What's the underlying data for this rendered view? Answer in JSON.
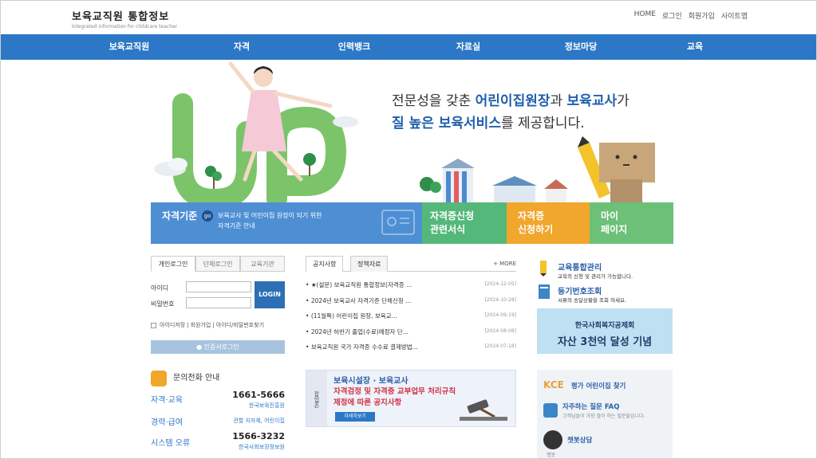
{
  "header": {
    "logo_title": "보육교직원 통합정보",
    "logo_subtitle": "Integrated information for childcare teacher",
    "util_links": [
      "HOME",
      "로그인",
      "회원가입",
      "사이트맵"
    ]
  },
  "nav": {
    "items": [
      "보육교직원",
      "자격",
      "인력뱅크",
      "자료실",
      "정보마당",
      "교육"
    ]
  },
  "hero": {
    "line1_pre": "전문성을 갖춘 ",
    "line1_hl1": "어린이집원장",
    "line1_mid": "과 ",
    "line1_hl2": "보육교사",
    "line1_post": "가",
    "line2_hl": "질 높은 보육서비스",
    "line2_post": "를 제공합니다."
  },
  "quickbar": {
    "qual_title": "자격기준",
    "go": "go",
    "qual_desc1": "보육교사 및 어린이집 원장이 되기 위한",
    "qual_desc2": "자격기준 안내",
    "apply_forms": [
      "자격증신청",
      "관련서식"
    ],
    "apply_cert": [
      "자격증",
      "신청하기"
    ],
    "mypage": [
      "마이",
      "페이지"
    ]
  },
  "login": {
    "tabs": [
      "개인로그인",
      "단체로그인",
      "교육기관"
    ],
    "id_label": "아이디",
    "pw_label": "비밀번호",
    "login_button": "LOGIN",
    "save_id": "아이디저장",
    "join": "회원가입",
    "find": "아이디/비밀번호찾기",
    "cert_login": "인증서로그인"
  },
  "inquiry": {
    "title": "문의전화 안내",
    "rows": [
      {
        "category": "자격·교육",
        "number": "1661-5666",
        "org": "한국보육진흥원"
      },
      {
        "category": "경력·급여",
        "number": "관할 지자체, 어린이집",
        "org": ""
      },
      {
        "category": "시스템 오류",
        "number": "1566-3232",
        "org": "한국사회보장정보원"
      }
    ]
  },
  "notice": {
    "tabs": [
      "공지사항",
      "정책자료"
    ],
    "more": "MORE",
    "items": [
      {
        "title": "★(설문) 보육교직원 통합정보(자격증 ...",
        "date": "[2024-12-05]"
      },
      {
        "title": "2024년 보육교사 자격기준 단체신청 ...",
        "date": "[2024-10-28]"
      },
      {
        "title": "(11월특) 어린이집 원장, 보육교...",
        "date": "[2024-09-19]"
      },
      {
        "title": "2024년 하반기 졸업(수료)예정자 단...",
        "date": "[2024-08-08]"
      },
      {
        "title": "보육교직원 국가 자격증 수수료 결제방법...",
        "date": "[2024-07-18]"
      }
    ]
  },
  "banner": {
    "side": "팝업존",
    "line1": "보육시설장 · 보육교사",
    "line2": "자격검정 및 자격증 교부업무 처리규칙",
    "line3": "제정에 따른 공지사항",
    "button": "자세히보기"
  },
  "right": {
    "edu_title": "교육통합관리",
    "edu_desc": "교육의 신청 및 관리가 가능합니다.",
    "reg_title": "등기번호조회",
    "reg_desc": "서류의 송달상황을 조회 하세요.",
    "banner_line1": "한국사회복지공제회",
    "banner_line2": "자산 3천억 달성 기념",
    "kce_logo": "KCE",
    "kce_text": "평가 어린이집 찾기",
    "faq_title": "자주하는 질문 FAQ",
    "faq_desc": "고객님들이 가장 많이 하는 질문들입니다.",
    "chatbot": "챗봇상담",
    "chatbot_sub": "챗봇"
  },
  "colors": {
    "nav_blue": "#2c78c6",
    "qual_blue": "#4e8fd4",
    "forms_green": "#54b87a",
    "cert_orange": "#f1a62c",
    "mypage_green": "#6cc078"
  }
}
